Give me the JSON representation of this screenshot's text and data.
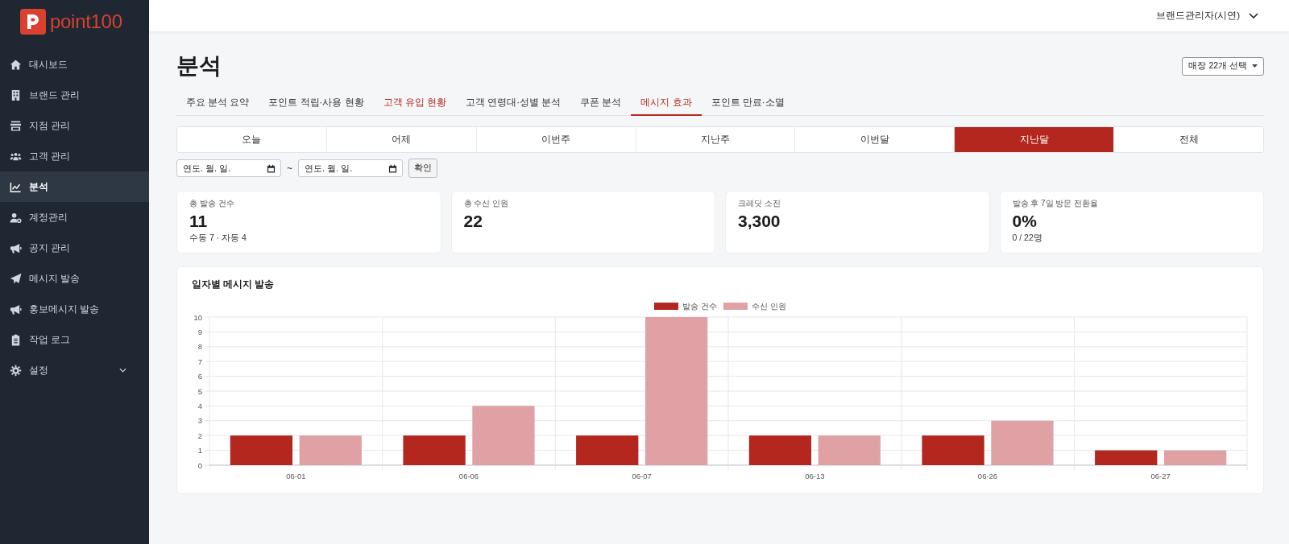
{
  "brand": {
    "name": "point100"
  },
  "sidebar": {
    "items": [
      {
        "label": "대시보드",
        "selected": false,
        "kind": "link"
      },
      {
        "label": "브랜드 관리",
        "selected": false,
        "kind": "link"
      },
      {
        "label": "지점 관리",
        "selected": false,
        "kind": "link"
      },
      {
        "label": "고객 관리",
        "selected": false,
        "kind": "link"
      },
      {
        "label": "분석",
        "selected": true,
        "kind": "link"
      },
      {
        "label": "계정관리",
        "selected": false,
        "kind": "link"
      },
      {
        "label": "공지 관리",
        "selected": false,
        "kind": "link"
      },
      {
        "label": "메시지 발송",
        "selected": false,
        "kind": "link"
      },
      {
        "label": "홍보메시지 발송",
        "selected": false,
        "kind": "link"
      },
      {
        "label": "작업 로그",
        "selected": false,
        "kind": "link"
      },
      {
        "label": "설정",
        "selected": false,
        "kind": "submenu"
      }
    ]
  },
  "topbar": {
    "user": "브랜드관리자(시연)"
  },
  "page": {
    "title": "분석",
    "store_filter": "매장 22개 선택"
  },
  "tabs": [
    {
      "label": "주요 분석 요약",
      "selected": false,
      "highlighted": false
    },
    {
      "label": "포인트 적립·사용 현황",
      "selected": false,
      "highlighted": false
    },
    {
      "label": "고객 유입 현황",
      "selected": false,
      "highlighted": true
    },
    {
      "label": "고객 연령대·성별 분석",
      "selected": false,
      "highlighted": false
    },
    {
      "label": "쿠폰 분석",
      "selected": false,
      "highlighted": false
    },
    {
      "label": "메시지 효과",
      "selected": true,
      "highlighted": false
    },
    {
      "label": "포인트 만료·소멸",
      "selected": false,
      "highlighted": false
    }
  ],
  "periods": [
    {
      "label": "오늘",
      "selected": false
    },
    {
      "label": "어제",
      "selected": false
    },
    {
      "label": "이번주",
      "selected": false
    },
    {
      "label": "지난주",
      "selected": false
    },
    {
      "label": "이번달",
      "selected": false
    },
    {
      "label": "지난달",
      "selected": true
    },
    {
      "label": "전체",
      "selected": false
    }
  ],
  "date_range": {
    "start": {
      "placeholder": "연도. 월. 일."
    },
    "separator": "~",
    "end": {
      "placeholder": "연도. 월. 일."
    },
    "confirm": "확인"
  },
  "stats": [
    {
      "label": "총 발송 건수",
      "value": "11",
      "sub": "수동 7 · 자동 4"
    },
    {
      "label": "총 수신 인원",
      "value": "22"
    },
    {
      "label": "크레딧 소진",
      "value": "3,300"
    },
    {
      "label": "발송 후 7일 방문 전환율",
      "value": "0%",
      "sub": "0 / 22명"
    }
  ],
  "chart": {
    "title": "일자별 메시지 발송",
    "chart_data": {
      "type": "bar",
      "categories": [
        "06-01",
        "06-06",
        "06-07",
        "06-13",
        "06-26",
        "06-27"
      ],
      "series": [
        {
          "name": "발송 건수",
          "color": "#b3271f",
          "values": [
            2,
            2,
            2,
            2,
            2,
            1
          ]
        },
        {
          "name": "수신 인원",
          "color": "#e0a1a5",
          "values": [
            2,
            4,
            10,
            2,
            3,
            1
          ]
        }
      ],
      "ylim": [
        0,
        10
      ],
      "yticks": [
        0,
        1,
        2,
        3,
        4,
        5,
        6,
        7,
        8,
        9,
        10
      ],
      "grid": true,
      "legend": "top"
    }
  }
}
